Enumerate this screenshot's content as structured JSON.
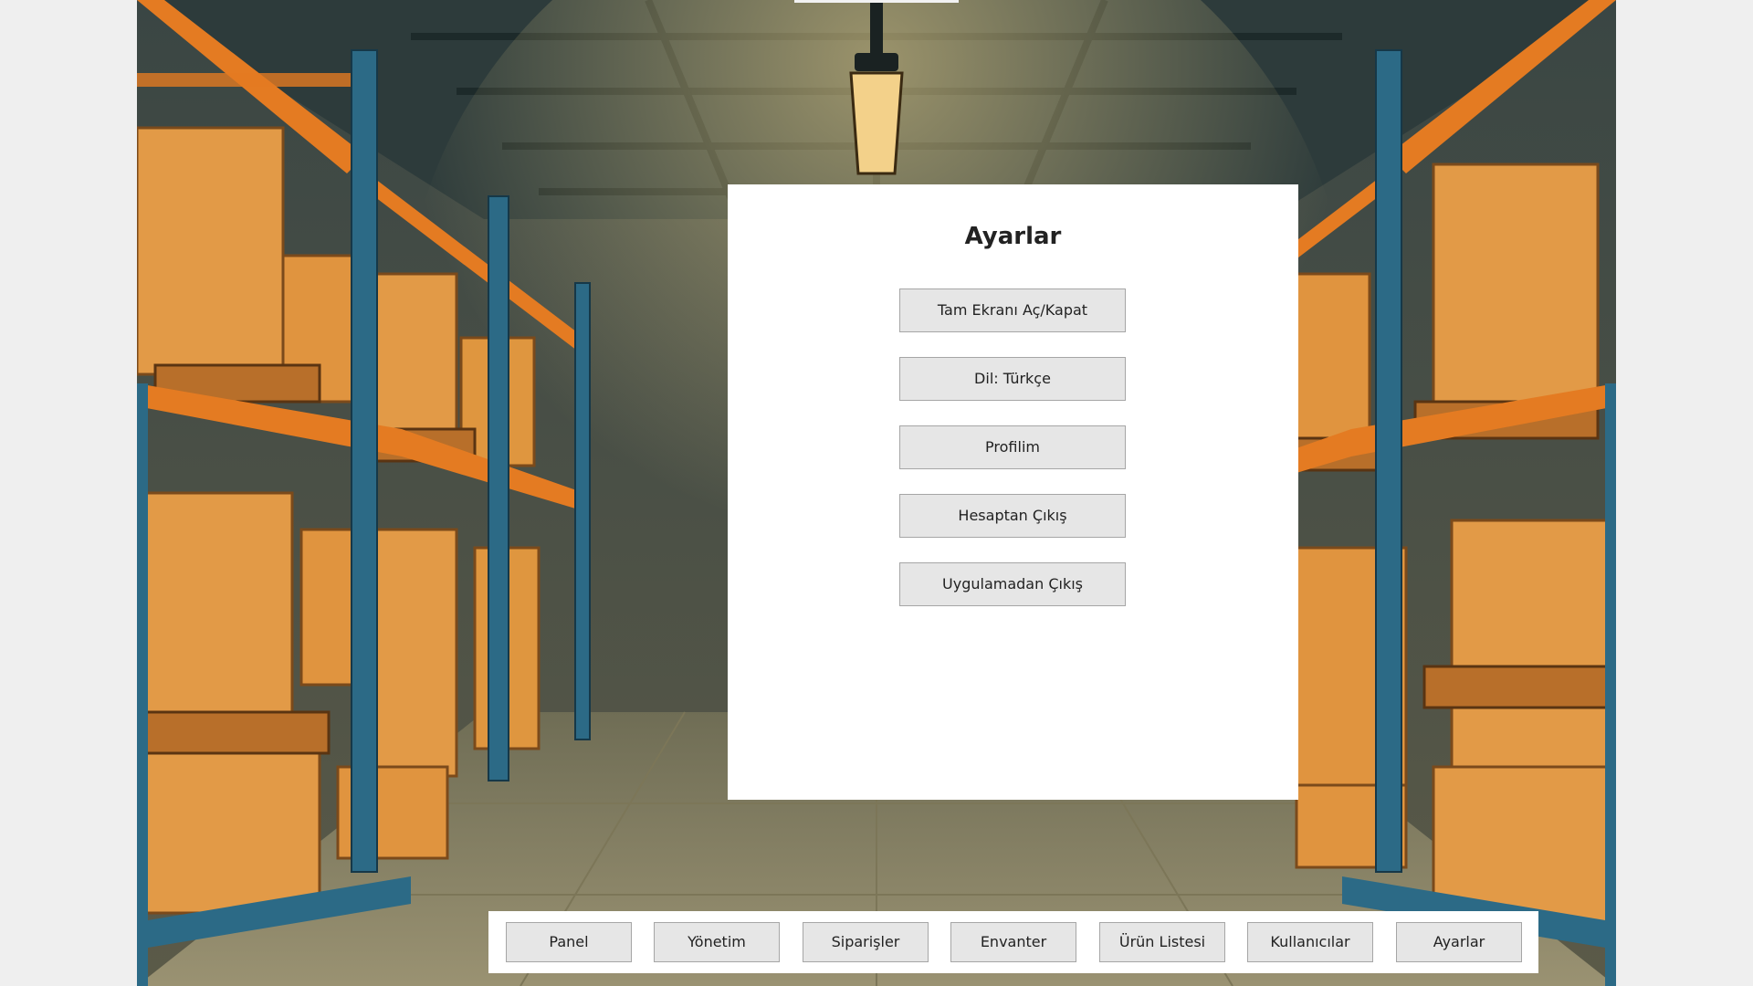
{
  "settings": {
    "title": "Ayarlar",
    "buttons": [
      {
        "label": "Tam Ekranı Aç/Kapat"
      },
      {
        "label": "Dil: Türkçe"
      },
      {
        "label": "Profilim"
      },
      {
        "label": "Hesaptan Çıkış"
      },
      {
        "label": "Uygulamadan Çıkış"
      }
    ]
  },
  "nav": {
    "items": [
      {
        "label": "Panel"
      },
      {
        "label": "Yönetim"
      },
      {
        "label": "Siparişler"
      },
      {
        "label": "Envanter"
      },
      {
        "label": "Ürün Listesi"
      },
      {
        "label": "Kullanıcılar"
      },
      {
        "label": "Ayarlar"
      }
    ]
  },
  "background": {
    "scene": "warehouse-illustration",
    "colors": {
      "shelf_post": "#2c6a86",
      "shelf_beam": "#e47b22",
      "box": "#e29a47",
      "floor": "#8a8465",
      "ceiling": "#2d3b3b"
    }
  }
}
